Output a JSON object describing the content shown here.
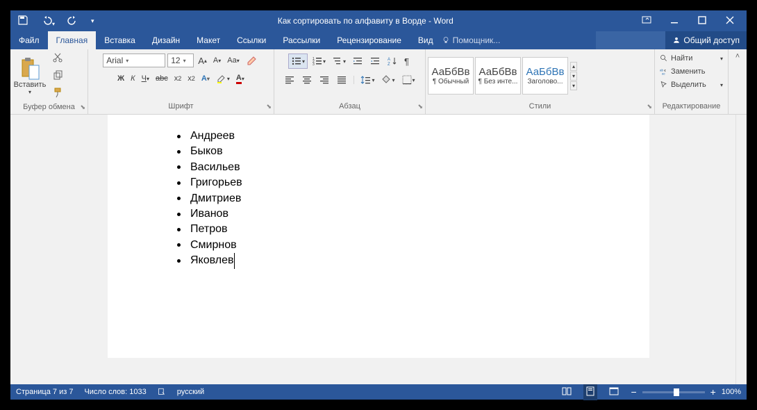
{
  "title": "Как сортировать по алфавиту в Ворде - Word",
  "tabs": [
    "Файл",
    "Главная",
    "Вставка",
    "Дизайн",
    "Макет",
    "Ссылки",
    "Рассылки",
    "Рецензирование",
    "Вид"
  ],
  "active_tab": 1,
  "tell_me": "Помощник...",
  "share": "Общий доступ",
  "groups": {
    "clipboard": {
      "label": "Буфер обмена",
      "paste": "Вставить"
    },
    "font": {
      "label": "Шрифт",
      "name": "Arial",
      "size": "12"
    },
    "paragraph": {
      "label": "Абзац"
    },
    "styles": {
      "label": "Стили",
      "items": [
        {
          "sample": "АаБбВв",
          "name": "¶ Обычный"
        },
        {
          "sample": "АаБбВв",
          "name": "¶ Без инте..."
        },
        {
          "sample": "АаБбВв",
          "name": "Заголово...",
          "blue": true
        }
      ]
    },
    "editing": {
      "label": "Редактирование",
      "find": "Найти",
      "replace": "Заменить",
      "select": "Выделить"
    }
  },
  "document": {
    "items": [
      "Андреев",
      "Быков",
      "Васильев",
      "Григорьев",
      "Дмитриев",
      "Иванов",
      "Петров",
      "Смирнов",
      "Яковлев"
    ]
  },
  "status": {
    "page": "Страница 7 из 7",
    "words": "Число слов: 1033",
    "lang": "русский",
    "zoom": "100%"
  }
}
